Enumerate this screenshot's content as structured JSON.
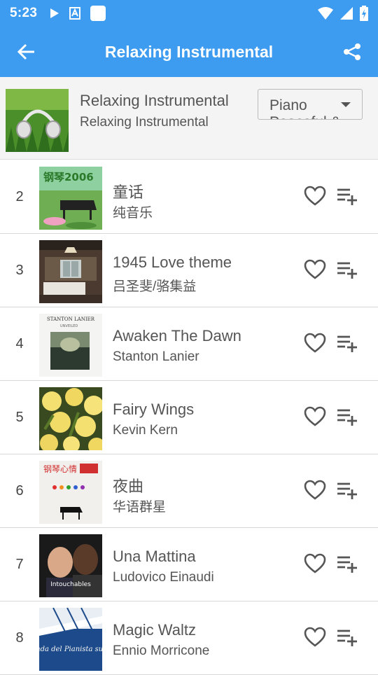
{
  "status_bar": {
    "time": "5:23"
  },
  "app_bar": {
    "title": "Relaxing Instrumental"
  },
  "playlist_header": {
    "title": "Relaxing Instrumental",
    "subtitle": "Relaxing Instrumental",
    "category_select": {
      "selected": "Piano",
      "next_option_partial": "Peaceful &"
    }
  },
  "tracks": [
    {
      "index": "2",
      "title": "童话",
      "artist": "纯音乐",
      "art_icon": "album-piano-icon"
    },
    {
      "index": "3",
      "title": "1945 Love theme",
      "artist": "吕圣斐/骆集益",
      "art_icon": "album-room-icon"
    },
    {
      "index": "4",
      "title": "Awaken The Dawn",
      "artist": "Stanton Lanier",
      "art_icon": "album-dawn-icon",
      "art_text": "STANTON LANIER",
      "art_sub": "UNVEILED"
    },
    {
      "index": "5",
      "title": "Fairy Wings",
      "artist": "Kevin Kern",
      "art_icon": "album-flowers-icon"
    },
    {
      "index": "6",
      "title": "夜曲",
      "artist": "华语群星",
      "art_icon": "album-piano-white-icon",
      "art_text": "钢琴心情"
    },
    {
      "index": "7",
      "title": "Una Mattina",
      "artist": "Ludovico Einaudi",
      "art_icon": "album-intouchables-icon",
      "art_text": "Intouchables"
    },
    {
      "index": "8",
      "title": "Magic Waltz",
      "artist": "Ennio Morricone",
      "art_icon": "album-pianist-icon",
      "art_text": "la Leggenda del Pianista sull'Oceano"
    }
  ],
  "colors": {
    "primary": "#3d9bf0",
    "text": "#555555",
    "divider": "#d8d8d8"
  }
}
